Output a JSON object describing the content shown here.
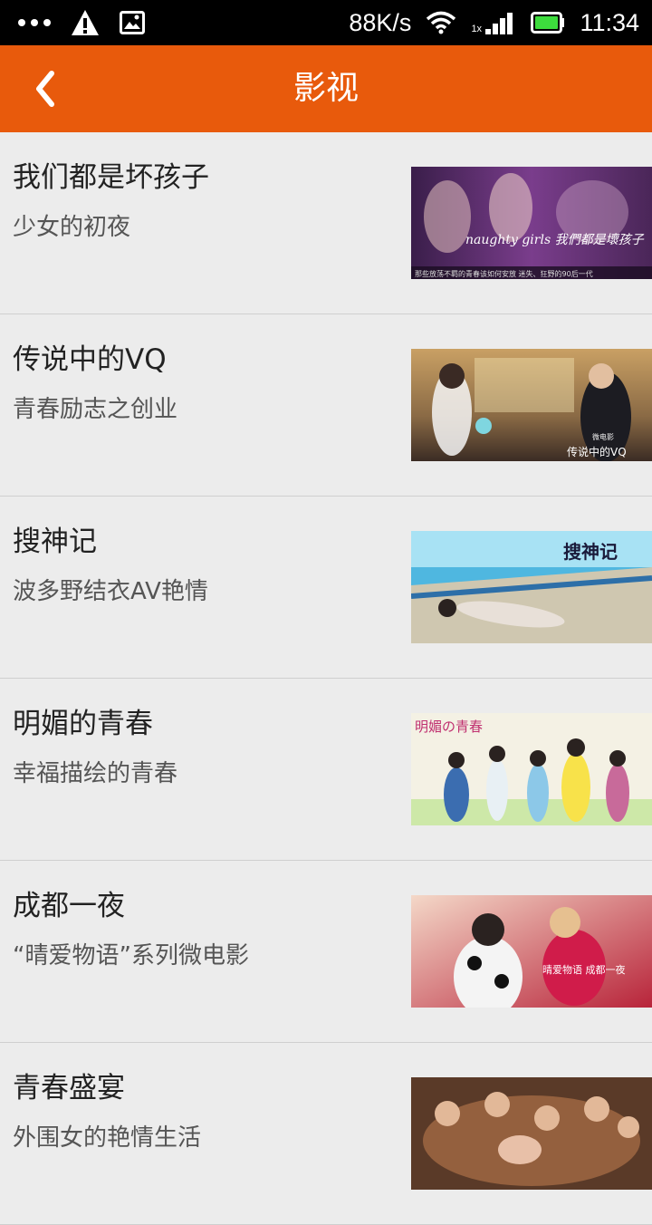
{
  "status_bar": {
    "network_speed": "88K/s",
    "signal_label": "1x",
    "time": "11:34",
    "icons": [
      "more-dots-icon",
      "warning-icon",
      "image-icon",
      "wifi-icon",
      "signal-icon",
      "battery-icon"
    ]
  },
  "nav": {
    "back_icon": "chevron-left-icon",
    "title": "影视"
  },
  "colors": {
    "accent": "#e85a0c",
    "background": "#ececec",
    "divider": "#cfcfcf"
  },
  "items": [
    {
      "title": "我们都是坏孩子",
      "subtitle": "少女的初夜",
      "thumb": {
        "overlay_text": "naughty girls 我們都是壞孩子",
        "caption": "那些放荡不羁的青春该如何安放 迷失、狂野的90后一代"
      }
    },
    {
      "title": "传说中的VQ",
      "subtitle": "青春励志之创业",
      "thumb": {
        "overlay_text": "传说中的VQ",
        "caption": "微电影"
      }
    },
    {
      "title": "搜神记",
      "subtitle": "波多野结衣AV艳情",
      "thumb": {
        "overlay_text": "搜神记"
      }
    },
    {
      "title": "明媚的青春",
      "subtitle": "幸福描绘的青春",
      "thumb": {
        "overlay_text": "明媚の青春"
      }
    },
    {
      "title": "成都一夜",
      "subtitle": "“晴爱物语”系列微电影",
      "thumb": {
        "overlay_text": "晴爱物语 成都一夜"
      }
    },
    {
      "title": "青春盛宴",
      "subtitle": "外围女的艳情生活",
      "thumb": {
        "overlay_text": ""
      }
    }
  ]
}
